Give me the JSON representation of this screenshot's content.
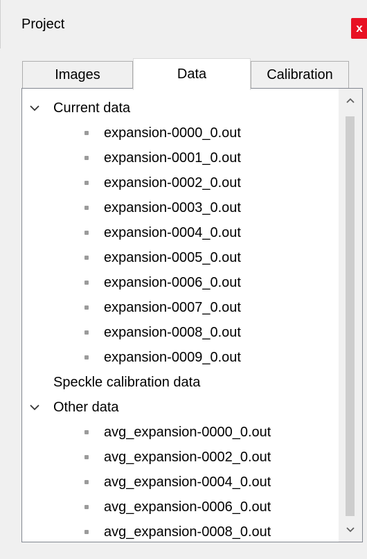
{
  "window": {
    "title": "Project",
    "close_label": "x"
  },
  "tabs": [
    {
      "label": "Images",
      "active": false
    },
    {
      "label": "Data",
      "active": true
    },
    {
      "label": "Calibration",
      "active": false
    }
  ],
  "tree": {
    "current": {
      "label": "Current data",
      "items": [
        "expansion-0000_0.out",
        "expansion-0001_0.out",
        "expansion-0002_0.out",
        "expansion-0003_0.out",
        "expansion-0004_0.out",
        "expansion-0005_0.out",
        "expansion-0006_0.out",
        "expansion-0007_0.out",
        "expansion-0008_0.out",
        "expansion-0009_0.out"
      ]
    },
    "speckle": {
      "label": "Speckle calibration data"
    },
    "other": {
      "label": "Other data",
      "items": [
        "avg_expansion-0000_0.out",
        "avg_expansion-0002_0.out",
        "avg_expansion-0004_0.out",
        "avg_expansion-0006_0.out",
        "avg_expansion-0008_0.out"
      ]
    }
  },
  "icons": {
    "expand": "chevron-down-icon",
    "bullet": "bullet-icon",
    "scroll_up": "scroll-up-icon",
    "scroll_down": "scroll-down-icon",
    "close": "close-icon"
  },
  "colors": {
    "close_button": "#e81123",
    "window_bg": "#f0f0f0",
    "panel_bg": "#ffffff",
    "scroll_thumb": "#cdcdcd"
  }
}
